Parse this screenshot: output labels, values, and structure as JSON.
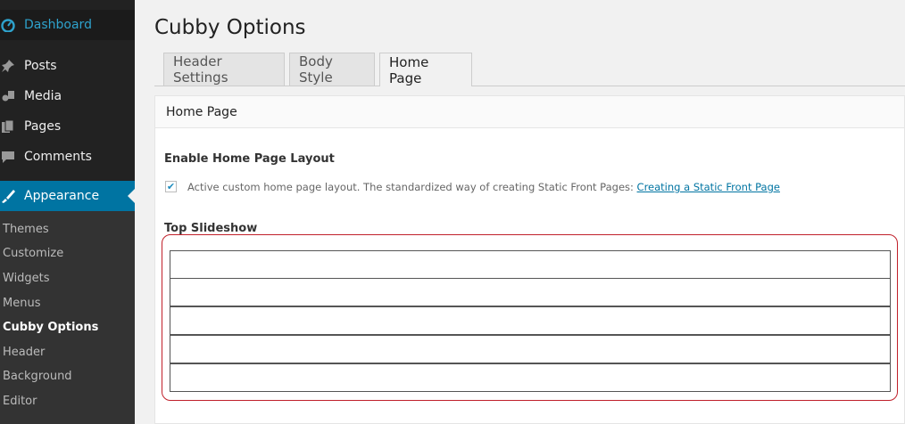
{
  "sidebar": {
    "dashboard": "Dashboard",
    "items": [
      "Posts",
      "Media",
      "Pages",
      "Comments"
    ],
    "appearance": "Appearance",
    "submenu": [
      "Themes",
      "Customize",
      "Widgets",
      "Menus",
      "Cubby Options",
      "Header",
      "Background",
      "Editor"
    ],
    "current_submenu": "Cubby Options"
  },
  "page": {
    "title": "Cubby Options"
  },
  "tabs": [
    {
      "label": "Header Settings",
      "active": false
    },
    {
      "label": "Body Style",
      "active": false
    },
    {
      "label": "Home Page",
      "active": true
    }
  ],
  "panel": {
    "title": "Home Page",
    "enable_label": "Enable Home Page Layout",
    "checkbox_checked": true,
    "checkbox_desc": "Active custom home page layout. The standardized way of creating Static Front Pages:",
    "checkbox_link": "Creating a Static Front Page",
    "slideshow_label": "Top Slideshow",
    "slideshow_rows": [
      "",
      "",
      "",
      "",
      ""
    ]
  },
  "colors": {
    "sidebar_bg": "#222222",
    "accent": "#0074a2",
    "highlight": "#c0202a"
  },
  "icons": {
    "dashboard": "dashboard-icon",
    "posts": "pin-icon",
    "media": "media-icon",
    "pages": "pages-icon",
    "comments": "comment-icon",
    "appearance": "brush-icon"
  }
}
